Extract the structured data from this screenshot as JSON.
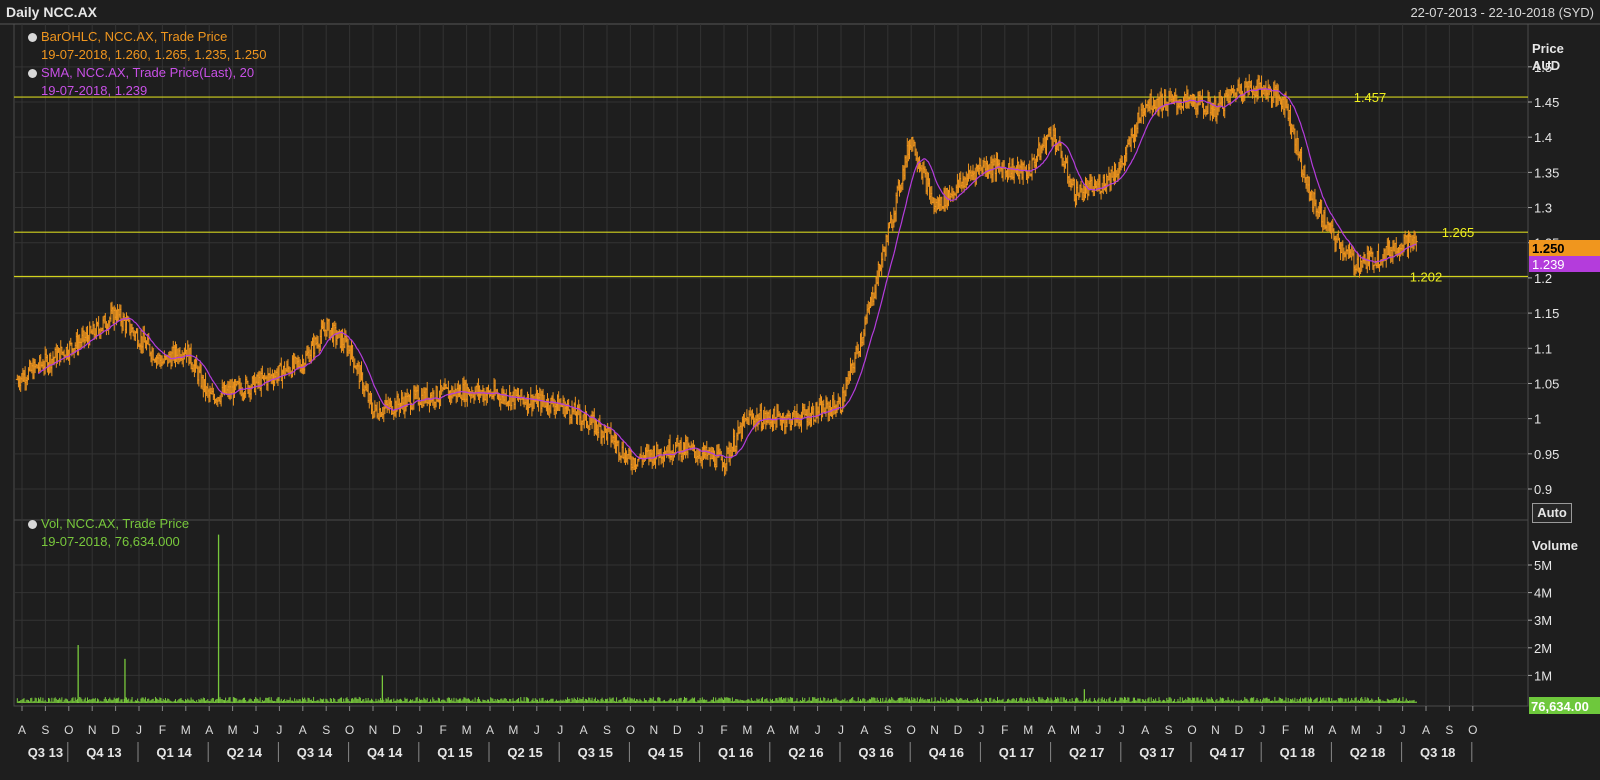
{
  "header": {
    "title": "Daily NCC.AX",
    "date_range": "22-07-2013 - 22-10-2018 (SYD)"
  },
  "legend_price": {
    "series1_name": "BarOHLC, NCC.AX, Trade Price",
    "series1_values": "19-07-2018, 1.260, 1.265, 1.235, 1.250",
    "series2_name": "SMA, NCC.AX, Trade Price(Last),  20",
    "series2_values": "19-07-2018, 1.239"
  },
  "legend_volume": {
    "series_name": "Vol, NCC.AX, Trade Price",
    "series_values": "19-07-2018, 76,634.000"
  },
  "price_axis": {
    "title_line1": "Price",
    "title_line2": "AUD",
    "auto_label": "Auto"
  },
  "volume_axis": {
    "title": "Volume"
  },
  "colors": {
    "bars": "#f0961e",
    "sma": "#b43cdc",
    "volume": "#78c83c",
    "hline": "#d2d21e",
    "background": "#1e1e1e",
    "grid": "#333333"
  },
  "chart_data": [
    {
      "type": "line",
      "title": "Daily NCC.AX",
      "ylabel": "Price AUD",
      "ylim": [
        0.87,
        1.53
      ],
      "yticks": [
        "1.5",
        "1.45",
        "1.4",
        "1.35",
        "1.3",
        "1.25",
        "1.2",
        "1.15",
        "1.1",
        "1.05",
        "1",
        "0.95",
        "0.9"
      ],
      "series": [
        {
          "name": "BarOHLC, NCC.AX, Trade Price",
          "style": "ohlc-bars",
          "approx_close_x": [
            "2013-07",
            "2013-09",
            "2013-11",
            "2013-12",
            "2014-02",
            "2014-03",
            "2014-04",
            "2014-06",
            "2014-08",
            "2014-09",
            "2014-10",
            "2014-11",
            "2015-01",
            "2015-03",
            "2015-05",
            "2015-07",
            "2015-09",
            "2015-10",
            "2015-12",
            "2016-02",
            "2016-03",
            "2016-05",
            "2016-07",
            "2016-08",
            "2016-09",
            "2016-10",
            "2016-11",
            "2017-01",
            "2017-03",
            "2017-04",
            "2017-05",
            "2017-06",
            "2017-07",
            "2017-08",
            "2017-10",
            "2017-11",
            "2017-12",
            "2018-01",
            "2018-02",
            "2018-03",
            "2018-04",
            "2018-05",
            "2018-06",
            "2018-07"
          ],
          "approx_close_y": [
            1.04,
            1.08,
            1.12,
            1.15,
            1.08,
            1.1,
            1.03,
            1.05,
            1.08,
            1.13,
            1.1,
            1.01,
            1.03,
            1.04,
            1.03,
            1.02,
            0.98,
            0.94,
            0.96,
            0.94,
            1.0,
            1.0,
            1.02,
            1.13,
            1.26,
            1.4,
            1.3,
            1.36,
            1.35,
            1.41,
            1.32,
            1.33,
            1.36,
            1.45,
            1.45,
            1.44,
            1.47,
            1.47,
            1.45,
            1.32,
            1.26,
            1.22,
            1.23,
            1.25
          ]
        },
        {
          "name": "SMA, NCC.AX, Trade Price(Last),  20",
          "style": "line"
        }
      ],
      "horizontal_lines": [
        {
          "value": 1.457,
          "label": "1.457"
        },
        {
          "value": 1.265,
          "label": "1.265"
        },
        {
          "value": 1.202,
          "label": "1.202"
        }
      ],
      "last_value_tags": [
        {
          "value": 1.25,
          "label": "1.250"
        },
        {
          "value": 1.239,
          "label": "1.239"
        }
      ]
    },
    {
      "type": "bar",
      "title": "",
      "ylabel": "Volume",
      "ylim": [
        0,
        6000000
      ],
      "yticks": [
        "5M",
        "4M",
        "3M",
        "2M",
        "1M"
      ],
      "series": [
        {
          "name": "Vol, NCC.AX, Trade Price",
          "spikes": [
            {
              "date": "2013-10",
              "value": 2100000
            },
            {
              "date": "2013-12",
              "value": 1600000
            },
            {
              "date": "2014-04",
              "value": 6100000
            },
            {
              "date": "2014-11",
              "value": 1000000
            },
            {
              "date": "2017-05",
              "value": 500000
            }
          ]
        }
      ],
      "last_value_tag": "76,634.00"
    }
  ],
  "x_axis": {
    "months": [
      "A",
      "S",
      "O",
      "N",
      "D",
      "J",
      "F",
      "M",
      "A",
      "M",
      "J",
      "J",
      "A",
      "S",
      "O",
      "N",
      "D",
      "J",
      "F",
      "M",
      "A",
      "M",
      "J",
      "J",
      "A",
      "S",
      "O",
      "N",
      "D",
      "J",
      "F",
      "M",
      "A",
      "M",
      "J",
      "J",
      "A",
      "S",
      "O",
      "N",
      "D",
      "J",
      "F",
      "M",
      "A",
      "M",
      "J",
      "J",
      "A",
      "S",
      "O",
      "N",
      "D",
      "J",
      "F",
      "M",
      "A",
      "M",
      "J",
      "J",
      "A",
      "S",
      "O"
    ],
    "quarters": [
      "Q3 13",
      "Q4 13",
      "Q1 14",
      "Q2 14",
      "Q3 14",
      "Q4 14",
      "Q1 15",
      "Q2 15",
      "Q3 15",
      "Q4 15",
      "Q1 16",
      "Q2 16",
      "Q3 16",
      "Q4 16",
      "Q1 17",
      "Q2 17",
      "Q3 17",
      "Q4 17",
      "Q1 18",
      "Q2 18",
      "Q3 18"
    ]
  }
}
